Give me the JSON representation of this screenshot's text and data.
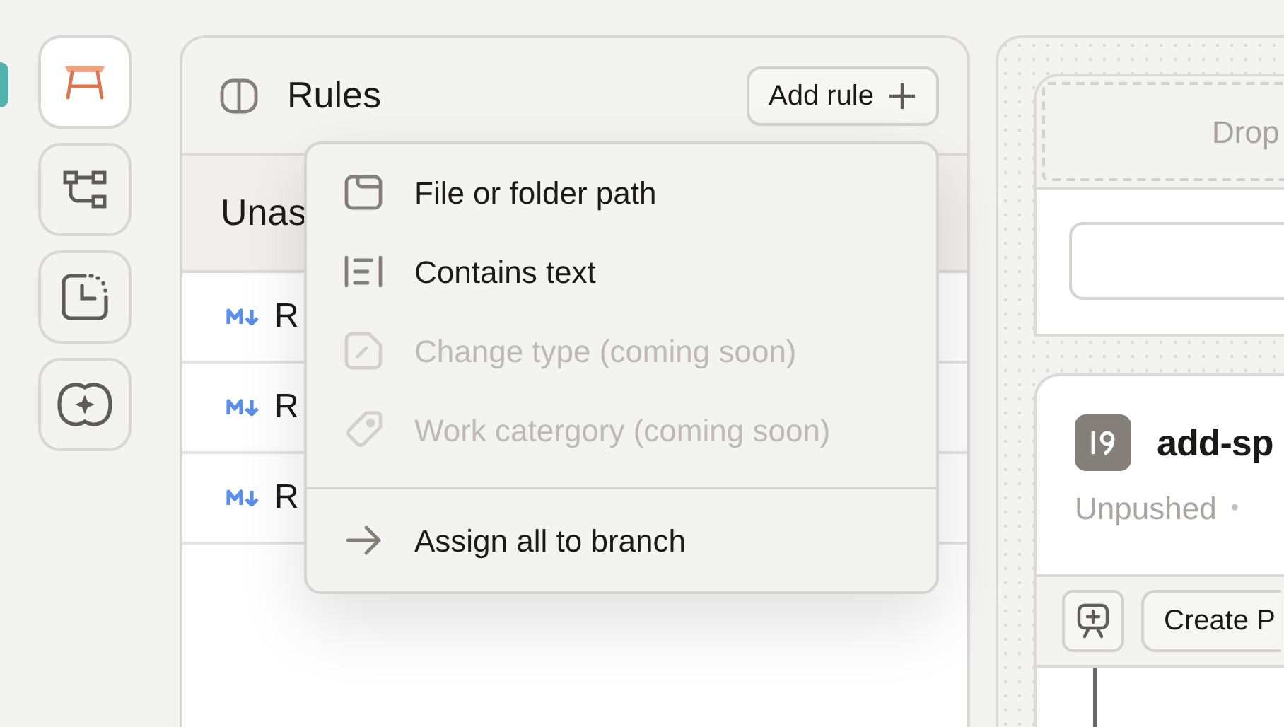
{
  "sidebar": {
    "items": [
      {
        "selected": true
      },
      {
        "selected": false
      },
      {
        "selected": false
      },
      {
        "selected": false
      }
    ]
  },
  "rules_panel": {
    "title": "Rules",
    "add_button": "Add rule",
    "section_title": "Unas",
    "files": [
      {
        "name": "R"
      },
      {
        "name": "R"
      },
      {
        "name": "R"
      }
    ]
  },
  "add_rule_menu": {
    "items": [
      {
        "label": "File or folder path",
        "disabled": false
      },
      {
        "label": "Contains text",
        "disabled": false
      },
      {
        "label": "Change type (coming soon)",
        "disabled": true
      },
      {
        "label": "Work catergory (coming soon)",
        "disabled": true
      }
    ],
    "footer_item": {
      "label": "Assign all to branch"
    }
  },
  "branch_lane": {
    "dropzone": "Drop",
    "branch": {
      "name": "add-sp",
      "status": "Unpushed",
      "bullet": "•",
      "create_button": "Create P"
    }
  }
}
